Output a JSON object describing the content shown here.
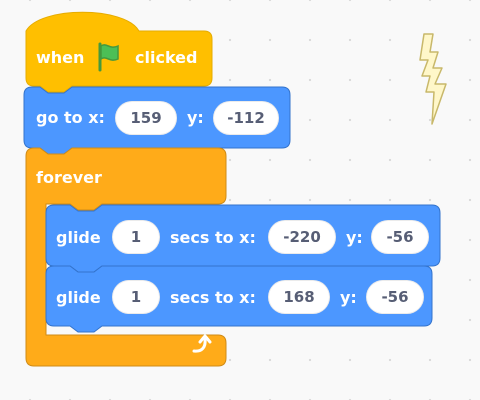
{
  "colors": {
    "events": "#ffbf00",
    "events_border": "#e6ac00",
    "motion": "#4c97ff",
    "motion_border": "#3373cc",
    "control": "#ffab19",
    "control_border": "#cf8b17",
    "flag": "#4cbf56"
  },
  "script": {
    "hat": {
      "prefix": "when",
      "icon": "green-flag-icon",
      "suffix": "clicked"
    },
    "goto": {
      "label_x": "go to x:",
      "x": "159",
      "label_y": "y:",
      "y": "-112"
    },
    "forever": {
      "label": "forever",
      "icon": "loop-arrow-icon"
    },
    "glide1": {
      "label_glide": "glide",
      "secs": "1",
      "label_secs": "secs to x:",
      "x": "-220",
      "label_y": "y:",
      "y": "-56"
    },
    "glide2": {
      "label_glide": "glide",
      "secs": "1",
      "label_secs": "secs to x:",
      "x": "168",
      "label_y": "y:",
      "y": "-56"
    }
  },
  "sprite_icon": "lightning-bolt-icon"
}
